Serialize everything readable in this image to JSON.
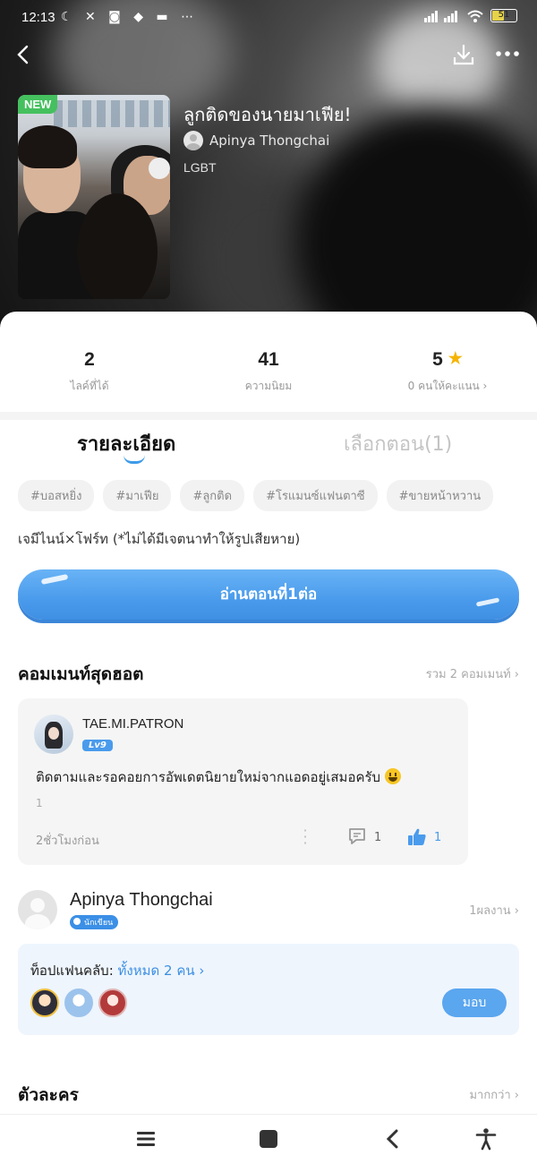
{
  "status_bar": {
    "time": "12:13",
    "battery": "51"
  },
  "book": {
    "badge": "NEW",
    "title": "ลูกติดของนายมาเฟีย!",
    "author": "Apinya Thongchai",
    "genre": "LGBT"
  },
  "stats": [
    {
      "value": "2",
      "label": "ไลค์ที่ได้"
    },
    {
      "value": "41",
      "label": "ความนิยม"
    },
    {
      "value": "5",
      "label": "0 คนให้คะแนน ›"
    }
  ],
  "tabs": {
    "detail": "รายละเอียด",
    "chapters": "เลือกตอน(1)"
  },
  "tags": [
    "#บอสหยิ่ง",
    "#มาเฟีย",
    "#ลูกติด",
    "#โรแมนซ์แฟนตาซี",
    "#ขายหน้าหวาน"
  ],
  "description": "เจมีไนน์×โฟร์ท (*ไม่ได้มีเจตนาทำให้รูปเสียหาย)",
  "read_button": "อ่านตอนที่1ต่อ",
  "hot_comments": {
    "title": "คอมเมนท์สุดฮอต",
    "total": "รวม 2 คอมเมนท์ ›",
    "comment": {
      "user": "TAE.MI.PATRON",
      "level": "Lv9",
      "text": "ติดตามและรอคอยการอัพเดตนิยายใหม่จากแอดอยู่เสมอครับ",
      "index": "1",
      "time": "2ชั่วโมงก่อน",
      "replies": "1",
      "likes": "1"
    }
  },
  "author_section": {
    "name": "Apinya Thongchai",
    "badge": "นักเขียน",
    "works": "1ผลงาน ›"
  },
  "fanclub": {
    "label": "ท็อปแฟนคลับ: ",
    "link": "ทั้งหมด 2 คน ›",
    "button": "มอบ"
  },
  "characters": {
    "title": "ตัวละคร",
    "more": "มากกว่า ›"
  },
  "colors": {
    "accent": "#4a9bec",
    "star": "#f5b400",
    "new_badge": "#45c05e"
  }
}
